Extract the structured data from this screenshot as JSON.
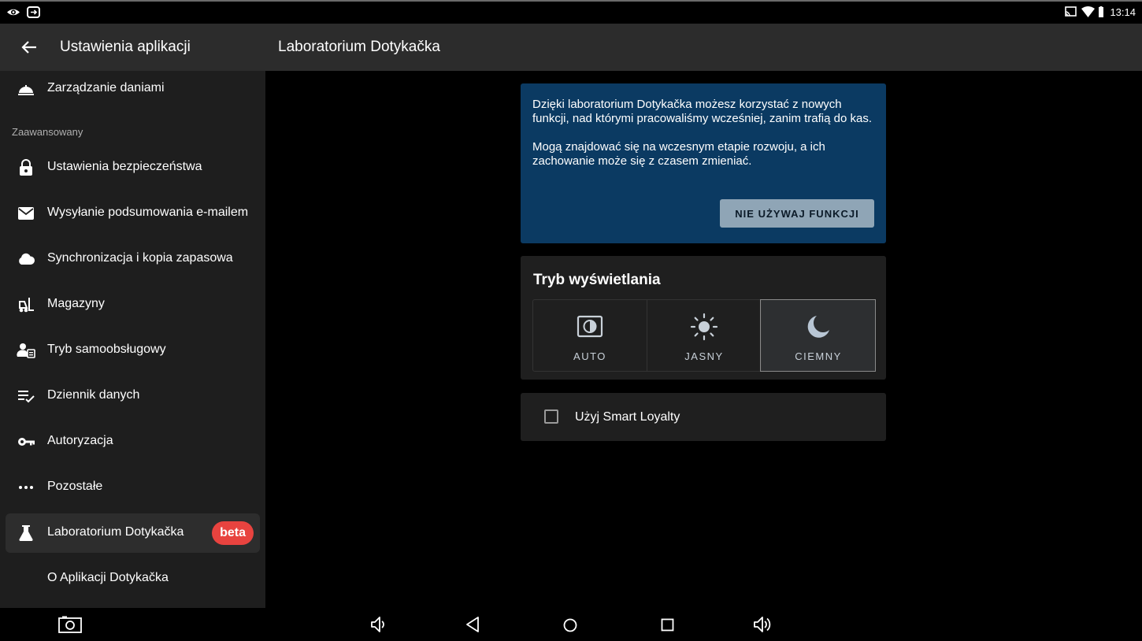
{
  "status_bar": {
    "time": "13:14",
    "icons": [
      "eye-icon",
      "screen-share-icon",
      "cast-icon",
      "wifi-icon",
      "battery-icon"
    ]
  },
  "sidebar": {
    "title": "Ustawienia aplikacji",
    "items_top": [
      {
        "label": "Zarządzanie daniami",
        "icon": "cloche-icon"
      }
    ],
    "section": "Zaawansowany",
    "items": [
      {
        "label": "Ustawienia bezpieczeństwa",
        "icon": "lock-icon"
      },
      {
        "label": "Wysyłanie podsumowania e-mailem",
        "icon": "email-icon"
      },
      {
        "label": "Synchronizacja i kopia zapasowa",
        "icon": "cloud-icon"
      },
      {
        "label": "Magazyny",
        "icon": "forklift-icon"
      },
      {
        "label": "Tryb samoobsługowy",
        "icon": "kiosk-user-icon"
      },
      {
        "label": "Dziennik danych",
        "icon": "checklist-icon"
      },
      {
        "label": "Autoryzacja",
        "icon": "key-icon"
      },
      {
        "label": "Pozostałe",
        "icon": "more-dots-icon"
      },
      {
        "label": "Laboratorium Dotykačka",
        "icon": "flask-icon",
        "badge": "beta",
        "active": true
      },
      {
        "label": "O Aplikacji Dotykačka"
      }
    ]
  },
  "main": {
    "title": "Laboratorium Dotykačka",
    "info": {
      "paragraph1": "Dzięki laboratorium Dotykačka możesz korzystać z nowych funkcji, nad którymi pracowaliśmy wcześniej, zanim trafią do kas.",
      "paragraph2": "Mogą znajdować się na wczesnym etapie rozwoju, a ich zachowanie może się z czasem zmieniać.",
      "button": "NIE UŻYWAJ FUNKCJI"
    },
    "display_mode": {
      "title": "Tryb wyświetlania",
      "options": [
        {
          "label": "AUTO",
          "icon": "brightness-auto-icon"
        },
        {
          "label": "JASNY",
          "icon": "sun-icon"
        },
        {
          "label": "CIEMNY",
          "icon": "moon-icon"
        }
      ],
      "selected": "CIEMNY"
    },
    "smart_loyalty": {
      "label": "Użyj Smart Loyalty",
      "checked": false
    }
  },
  "colors": {
    "info_bg": "#0b3a62",
    "badge": "#e8433f",
    "button": "#8fa5b6",
    "header": "#2c2c2c",
    "sidebar": "#1e1e1e"
  },
  "nav_bar": {
    "icons": [
      "screenshot-icon",
      "volume-down-icon",
      "back-icon",
      "home-icon",
      "recents-icon",
      "volume-up-icon"
    ]
  }
}
